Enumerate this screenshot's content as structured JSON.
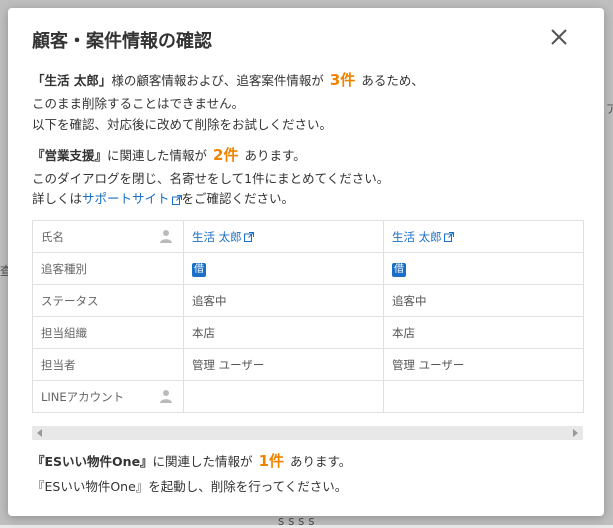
{
  "background": {
    "fragment_left": "查",
    "fragment_right": "ア",
    "fragment_bottom": "s s s s"
  },
  "modal": {
    "title": "顧客・案件情報の確認",
    "close_icon": "close-icon"
  },
  "intro": {
    "name_quoted": "「生活 太郎」",
    "text_after_name": "様の顧客情報および、追客案件情報が",
    "count": "3件",
    "text_after_count": "あるため、",
    "line2": "このまま削除することはできません。",
    "line3": "以下を確認、対応後に改めて削除をお試しください。"
  },
  "eigyo": {
    "name_quoted": "『営業支援』",
    "text_after_name": "に関連した情報が",
    "count": "2件",
    "text_after_count": "あります。",
    "line2": "このダイアログを閉じ、名寄せをして1件にまとめてください。",
    "line3_prefix": "詳しくは",
    "support_link": "サポートサイト",
    "line3_suffix": "をご確認ください。"
  },
  "table": {
    "rows": [
      {
        "label": "氏名",
        "icon": "person-icon",
        "values": [
          "生活 太郎",
          "生活 太郎"
        ]
      },
      {
        "label": "追客種別",
        "values": [
          "借",
          "借"
        ]
      },
      {
        "label": "ステータス",
        "values": [
          "追客中",
          "追客中"
        ]
      },
      {
        "label": "担当組織",
        "values": [
          "本店",
          "本店"
        ]
      },
      {
        "label": "担当者",
        "values": [
          "管理 ユーザー",
          "管理 ユーザー"
        ]
      },
      {
        "label": "LINEアカウント",
        "icon": "person-icon",
        "values": [
          "",
          ""
        ]
      }
    ]
  },
  "es": {
    "name_quoted": "『ESいい物件One』",
    "text_after_name": "に関連した情報が",
    "count": "1件",
    "text_after_count": "あります。",
    "line2": "『ESいい物件One』を起動し、削除を行ってください。"
  },
  "colors": {
    "accent_orange": "#f08300",
    "link_blue": "#1a6fc6"
  }
}
